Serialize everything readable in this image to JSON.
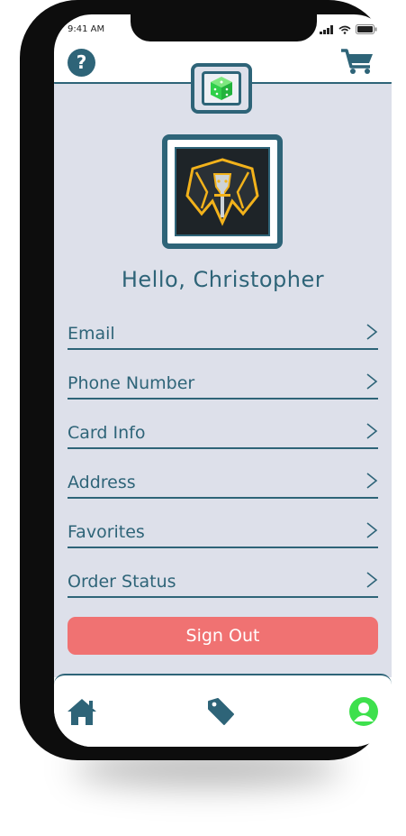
{
  "status_bar": {
    "time": "9:41 AM"
  },
  "header": {
    "help_label": "?"
  },
  "profile": {
    "greeting": "Hello, Christopher"
  },
  "menu": [
    {
      "label": "Email"
    },
    {
      "label": "Phone Number"
    },
    {
      "label": "Card Info"
    },
    {
      "label": "Address"
    },
    {
      "label": "Favorites"
    },
    {
      "label": "Order Status"
    }
  ],
  "sign_out_label": "Sign Out",
  "bottom_nav": [
    "home-icon",
    "tag-icon",
    "profile-icon"
  ],
  "colors": {
    "primary": "#2e6478",
    "background": "#dde0ea",
    "danger": "#f07272",
    "active": "#3ee04d"
  }
}
